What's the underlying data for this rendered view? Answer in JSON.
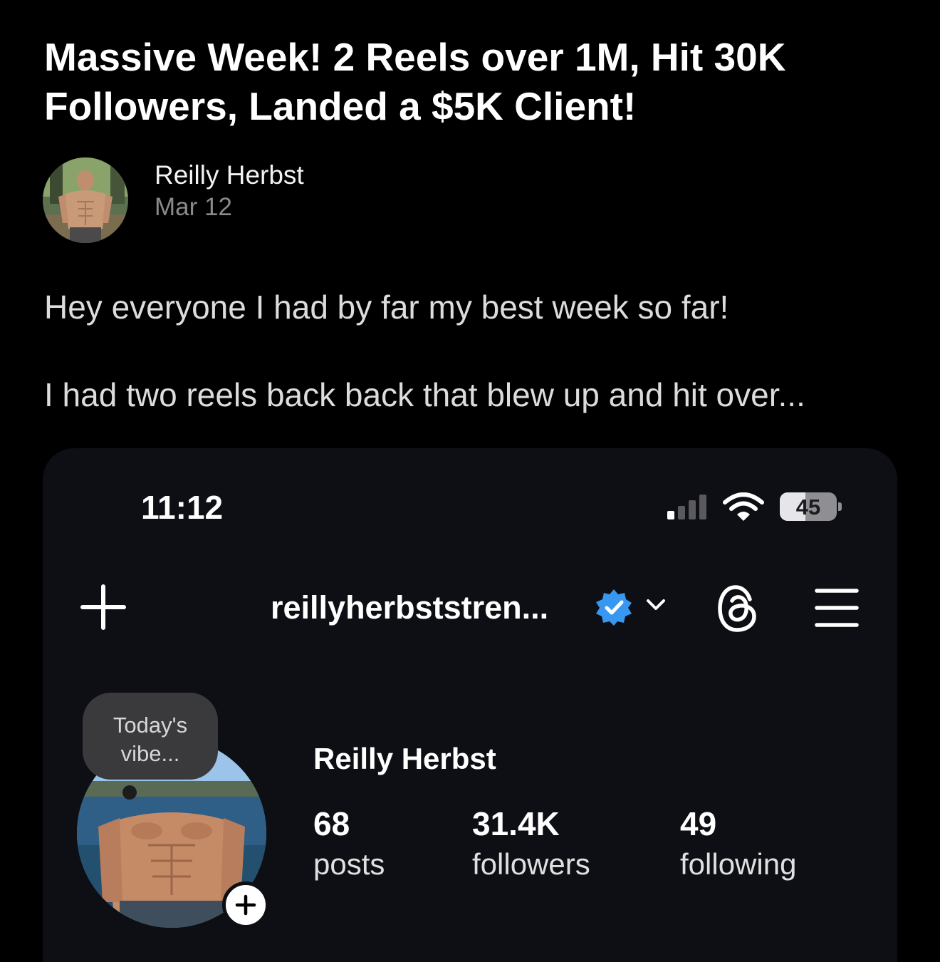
{
  "post": {
    "title": "Massive Week! 2 Reels over 1M, Hit 30K Followers, Landed a $5K Client!",
    "author_name": "Reilly Herbst",
    "date": "Mar 12",
    "body_line_1": "Hey everyone I had by far my best week so far!",
    "body_line_2": "I had two reels back back that blew up and hit over..."
  },
  "screenshot": {
    "status_bar": {
      "time": "11:12",
      "battery_level": "45",
      "battery_fraction": 0.45,
      "icons": [
        "signal-icon",
        "wifi-icon",
        "battery-icon"
      ]
    },
    "nav": {
      "handle": "reillyherbststren...",
      "icons": [
        "plus-icon",
        "verified-icon",
        "chevron-down-icon",
        "threads-icon",
        "menu-icon"
      ]
    },
    "note": {
      "line_1": "Today's",
      "line_2": "vibe..."
    },
    "profile": {
      "name": "Reilly Herbst",
      "stats": [
        {
          "value": "68",
          "label": "posts"
        },
        {
          "value": "31.4K",
          "label": "followers"
        },
        {
          "value": "49",
          "label": "following"
        }
      ]
    }
  },
  "colors": {
    "background": "#000000",
    "card": "#0d0f14",
    "verified_blue": "#3897f0",
    "muted_text": "#8a8a8e"
  }
}
